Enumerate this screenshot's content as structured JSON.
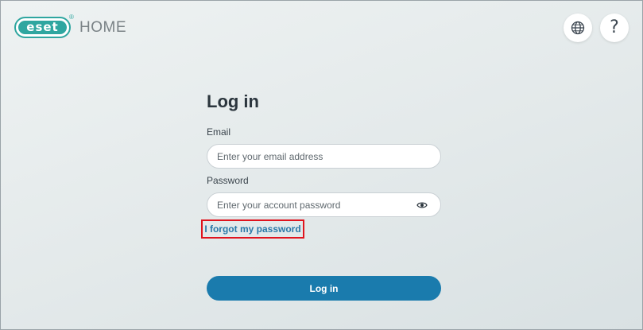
{
  "header": {
    "logo_text": "eset",
    "logo_reg": "®",
    "product_name": "HOME",
    "brand_color": "#2fa6a0",
    "language_icon": "globe-icon",
    "help_icon": "question-mark-icon",
    "help_glyph": "?"
  },
  "login": {
    "title": "Log in",
    "email_label": "Email",
    "email_placeholder": "Enter your email address",
    "email_value": "",
    "password_label": "Password",
    "password_placeholder": "Enter your account password",
    "password_value": "",
    "show_password_icon": "eye-icon",
    "forgot_password": "I forgot my password",
    "submit_label": "Log in",
    "accent_color": "#1a7bad",
    "highlight_color": "#e0141e"
  }
}
